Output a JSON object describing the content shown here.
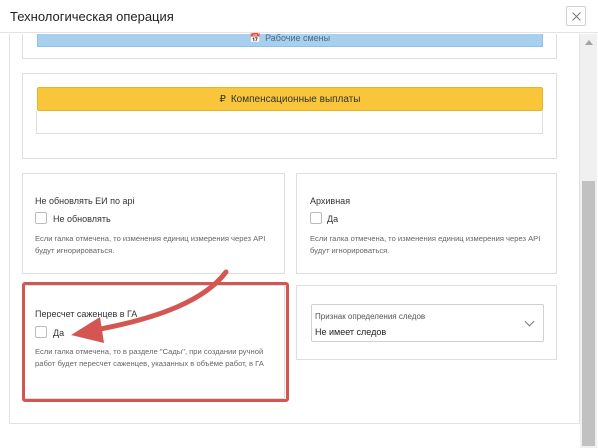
{
  "window": {
    "title": "Технологическая операция"
  },
  "buttons": {
    "work_shifts_label": "Рабочие смены",
    "work_shifts_icon": "calendar-icon",
    "compensation_label": "Компенсационные выплаты",
    "compensation_icon_glyph": "₽"
  },
  "fields": {
    "no_update_units": {
      "title": "Не обновлять ЕИ по api",
      "checkbox_label": "Не обновлять",
      "hint": "Если галка отмечена, то изменения единиц измерения через API будут игнорироваться."
    },
    "archive": {
      "title": "Архивная",
      "checkbox_label": "Да",
      "hint": "Если галка отмечена, то изменения единиц измерения через API будут игнорироваться."
    },
    "seedling_recount": {
      "title": "Пересчет саженцев в ГА",
      "checkbox_label": "Да",
      "hint": "Если галка отмечена, то в разделе \"Сады\", при создании ручной работ будет пересчет саженцев, указанных в объёме работ, в ГА"
    },
    "trace_detection": {
      "label": "Признак определения следов",
      "value": "Не имеет следов"
    }
  },
  "annotation": {
    "color": "#d45652"
  }
}
